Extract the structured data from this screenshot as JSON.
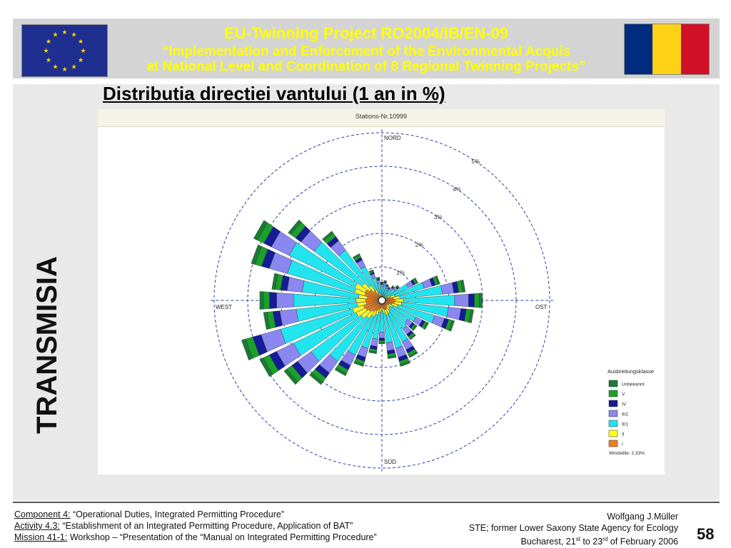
{
  "header": {
    "line1": "EU-Twinning  Project  RO2004/IB/EN-09",
    "line2": "“Implementation and Enforcement of the Environmental Acquis",
    "line3": "at National Level and Coordination of 8 Regional Twinning Projects”",
    "text_color": "#ffff00",
    "eu_flag_color": "#1f2f8f",
    "ro_flag_colors": [
      "#002b7f",
      "#fcd116",
      "#ce1126"
    ]
  },
  "vertical_label": "TRANSMISIA",
  "slide_title": "Distributia directiei vantului (1 an in %)",
  "chart_data": {
    "type": "windrose",
    "station": "Stations-Nr.10999",
    "directions": {
      "north": "NORD",
      "east": "OST",
      "south": "SÜD",
      "west": "WEST"
    },
    "rings": [
      {
        "label": "1%",
        "value": 1
      },
      {
        "label": "2%",
        "value": 2
      },
      {
        "label": "3%",
        "value": 3
      },
      {
        "label": "4%",
        "value": 4
      },
      {
        "label": "5%",
        "value": 5
      }
    ],
    "sector_count": 36,
    "sector_angles_deg": [
      0,
      10,
      20,
      30,
      40,
      50,
      60,
      70,
      80,
      90,
      100,
      110,
      120,
      130,
      140,
      150,
      160,
      170,
      180,
      190,
      200,
      210,
      220,
      230,
      240,
      250,
      260,
      270,
      280,
      290,
      300,
      310,
      320,
      330,
      340,
      350
    ],
    "stack_order": [
      "I",
      "II",
      "III1",
      "III2",
      "IV",
      "V",
      "Unbekannt"
    ],
    "cumulative_totals": [
      0.55,
      0.6,
      0.5,
      0.45,
      0.55,
      0.65,
      1.2,
      1.8,
      2.5,
      3.0,
      2.75,
      2.25,
      1.55,
      1.3,
      1.45,
      1.9,
      2.05,
      1.75,
      1.3,
      1.6,
      2.05,
      2.5,
      3.1,
      3.6,
      4.05,
      4.35,
      3.55,
      3.65,
      3.3,
      4.05,
      4.25,
      3.45,
      2.55,
      1.55,
      0.95,
      0.7
    ],
    "legend": {
      "title": "Ausbreitungsklasse",
      "items": [
        {
          "label": "Unbekannt",
          "color": "#1b7a35"
        },
        {
          "label": "V",
          "color": "#1aa12a"
        },
        {
          "label": "IV",
          "color": "#141c96"
        },
        {
          "label": "III2",
          "color": "#8a87f0"
        },
        {
          "label": "III1",
          "color": "#22e4ef"
        },
        {
          "label": "II",
          "color": "#ffff1e"
        },
        {
          "label": "I",
          "color": "#f07e1e"
        }
      ],
      "calm": "Windstille: 2.33%"
    }
  },
  "footer": {
    "left": [
      {
        "label": "Component 4:",
        "text": " “Operational Duties, Integrated Permitting Procedure”"
      },
      {
        "label": "Activity 4.3:",
        "text": " “Establishment of an Integrated Permitting Procedure, Application of BAT”"
      },
      {
        "label": "Mission 41-1:",
        "text": " Workshop – “Presentation of the “Manual on Integrated Permitting Procedure”"
      }
    ],
    "right": {
      "author": "Wolfgang J.Müller",
      "affiliation": "STE; former Lower Saxony State Agency for Ecology",
      "dates_prefix": "Bucharest, 21",
      "sup1": "st",
      "dates_mid": " to 23",
      "sup2": "rd",
      "dates_suffix": " of February 2006"
    },
    "page_number": "58"
  }
}
